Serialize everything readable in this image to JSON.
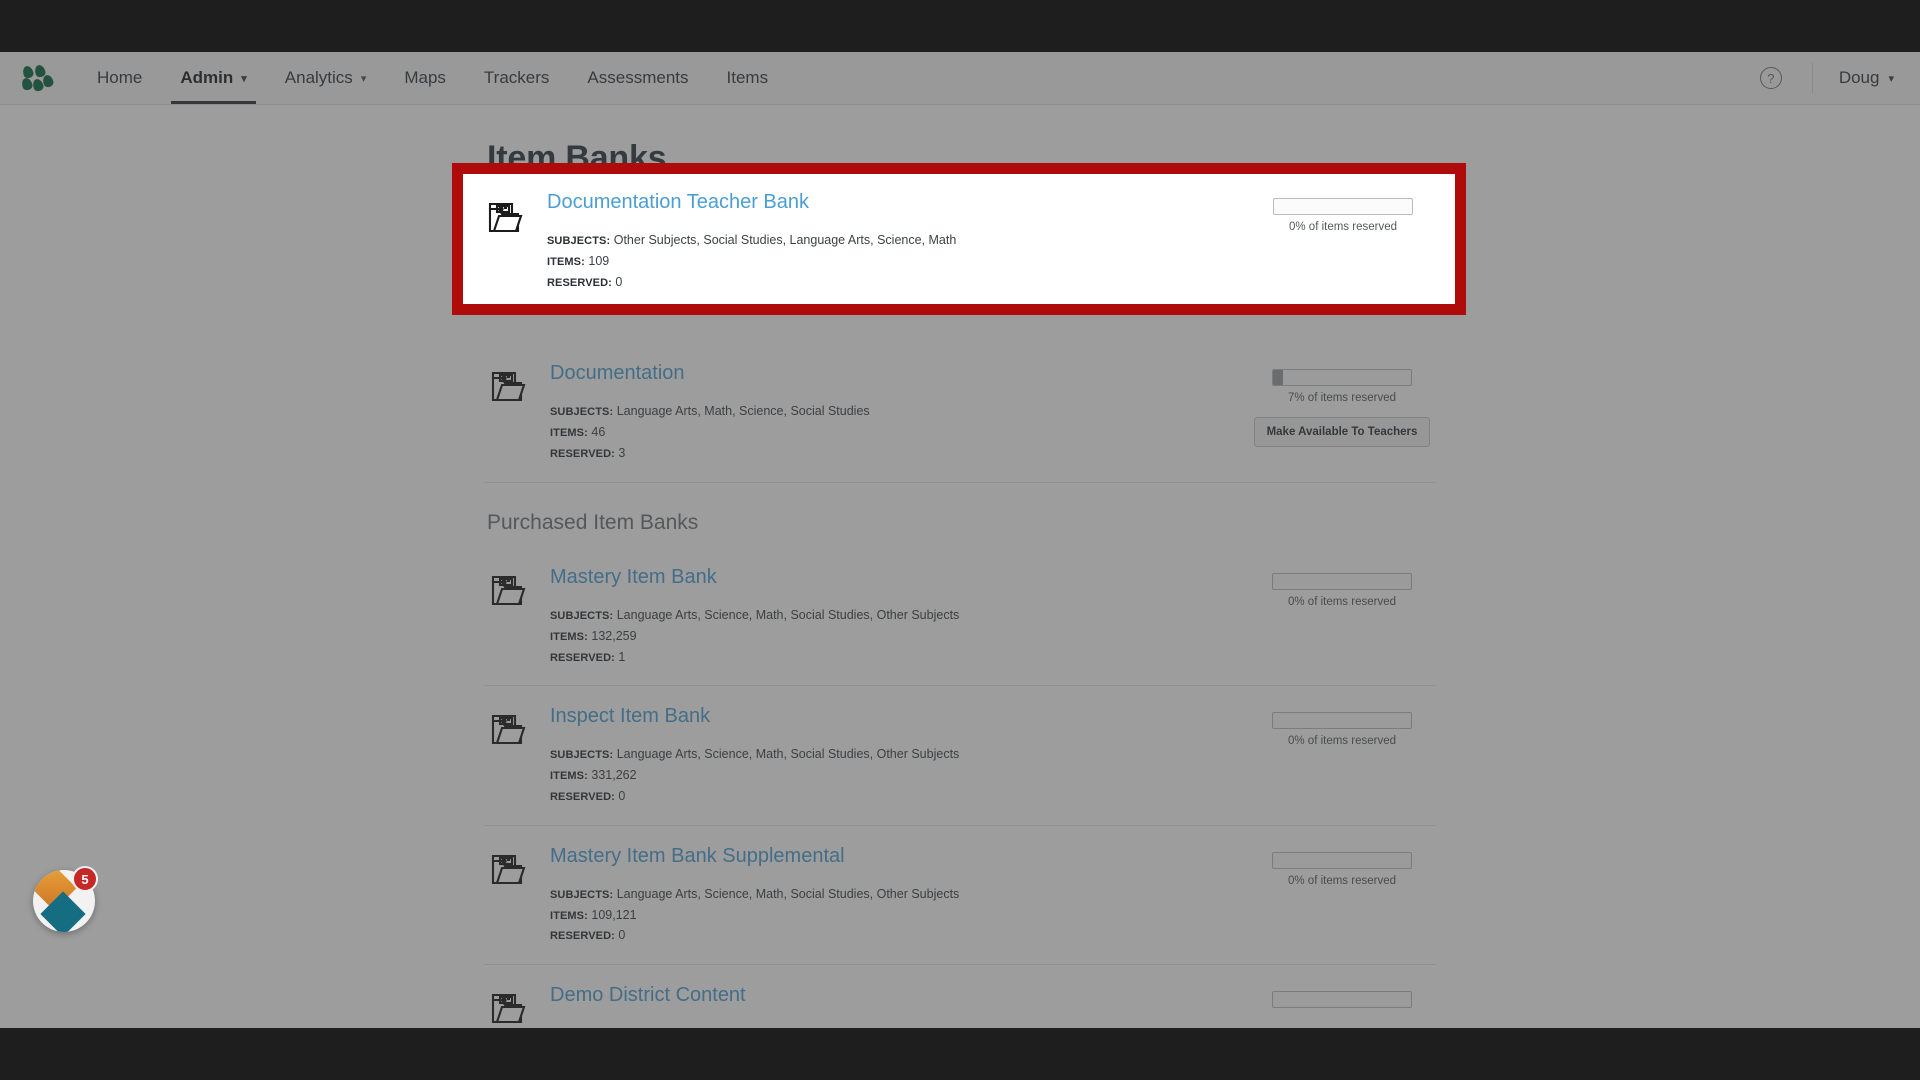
{
  "nav": {
    "logo_icon": "leaf-cluster-logo",
    "items": [
      {
        "label": "Home",
        "has_caret": false,
        "active": false
      },
      {
        "label": "Admin",
        "has_caret": true,
        "active": true
      },
      {
        "label": "Analytics",
        "has_caret": true,
        "active": false
      },
      {
        "label": "Maps",
        "has_caret": false,
        "active": false
      },
      {
        "label": "Trackers",
        "has_caret": false,
        "active": false
      },
      {
        "label": "Assessments",
        "has_caret": false,
        "active": false
      },
      {
        "label": "Items",
        "has_caret": false,
        "active": false
      }
    ],
    "help_icon": "question-mark-icon",
    "help_label": "?",
    "user_label": "Doug",
    "caret": "⌄"
  },
  "page": {
    "title": "Item Banks",
    "section_title": "Purchased Item Banks"
  },
  "labels": {
    "subjects": "SUBJECTS:",
    "items": "ITEMS:",
    "reserved": "RESERVED:"
  },
  "spotlight": {
    "name": "Documentation Teacher Bank",
    "subjects": "Other Subjects, Social Studies, Language Arts, Science, Math",
    "items": "109",
    "reserved": "0",
    "progress_pct": 0,
    "progress_label": "0% of items reserved",
    "border_color": "#b00b0b"
  },
  "my_banks": [
    {
      "name": "Documentation",
      "subjects": "Language Arts, Math, Science, Social Studies",
      "items": "46",
      "reserved": "3",
      "progress_pct": 7,
      "progress_label": "7% of items reserved",
      "button_label": "Make Available To Teachers"
    }
  ],
  "purchased_banks": [
    {
      "name": "Mastery Item Bank",
      "subjects": "Language Arts, Science, Math, Social Studies, Other Subjects",
      "items": "132,259",
      "reserved": "1",
      "progress_pct": 0,
      "progress_label": "0% of items reserved",
      "button_label": ""
    },
    {
      "name": "Inspect Item Bank",
      "subjects": "Language Arts, Science, Math, Social Studies, Other Subjects",
      "items": "331,262",
      "reserved": "0",
      "progress_pct": 0,
      "progress_label": "0% of items reserved",
      "button_label": ""
    },
    {
      "name": "Mastery Item Bank Supplemental",
      "subjects": "Language Arts, Science, Math, Social Studies, Other Subjects",
      "items": "109,121",
      "reserved": "0",
      "progress_pct": 0,
      "progress_label": "0% of items reserved",
      "button_label": ""
    },
    {
      "name": "Demo District Content",
      "subjects": "",
      "items": "",
      "reserved": "",
      "progress_pct": 0,
      "progress_label": "",
      "button_label": ""
    }
  ],
  "chat_widget": {
    "icon": "chat-diamonds-icon",
    "badge_count": "5",
    "badge_color": "#c62828"
  },
  "colors": {
    "link": "#4a9ed4",
    "brand_green": "#0b6b45",
    "highlight_red": "#b00b0b"
  }
}
